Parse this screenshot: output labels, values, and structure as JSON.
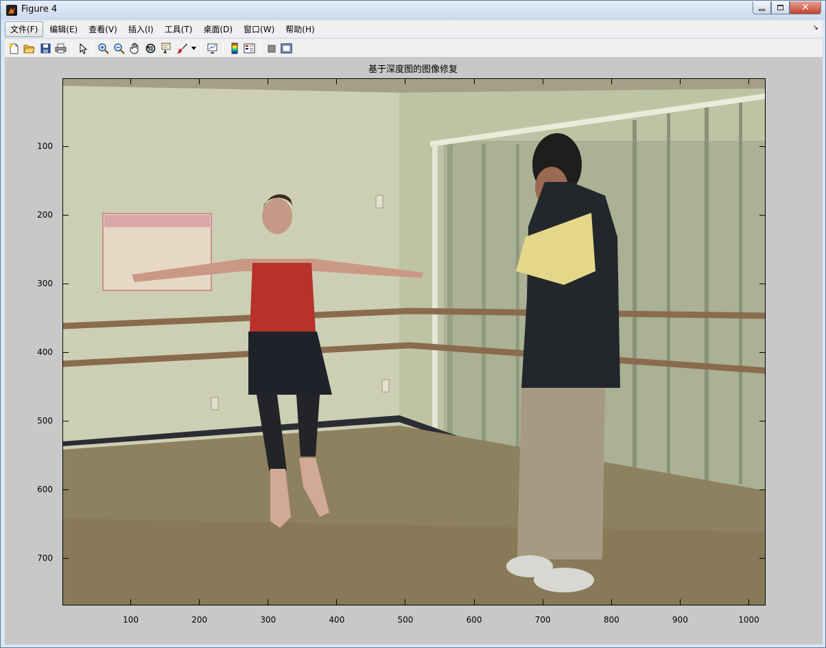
{
  "window": {
    "title": "Figure 4"
  },
  "menu": {
    "items": [
      "文件(F)",
      "编辑(E)",
      "查看(V)",
      "插入(I)",
      "工具(T)",
      "桌面(D)",
      "窗口(W)",
      "帮助(H)"
    ],
    "active_index": 0
  },
  "toolbar": {
    "buttons": [
      "new-figure-icon",
      "open-file-icon",
      "save-icon",
      "print-icon",
      "edit-plot-pointer-icon",
      "zoom-in-icon",
      "zoom-out-icon",
      "pan-hand-icon",
      "rotate-3d-icon",
      "data-cursor-icon",
      "brush-icon",
      "brush-dropdown-icon",
      "link-plot-icon",
      "insert-colorbar-icon",
      "insert-legend-icon",
      "hide-plot-tools-icon",
      "show-plot-tools-icon"
    ]
  },
  "plot": {
    "title": "基于深度图的图像修复",
    "x_ticks": [
      "100",
      "200",
      "300",
      "400",
      "500",
      "600",
      "700",
      "800",
      "900",
      "1000"
    ],
    "y_ticks": [
      "100",
      "200",
      "300",
      "400",
      "500",
      "600",
      "700"
    ],
    "x_range": [
      0.5,
      1024.5
    ],
    "y_range": [
      0.5,
      768.5
    ]
  }
}
